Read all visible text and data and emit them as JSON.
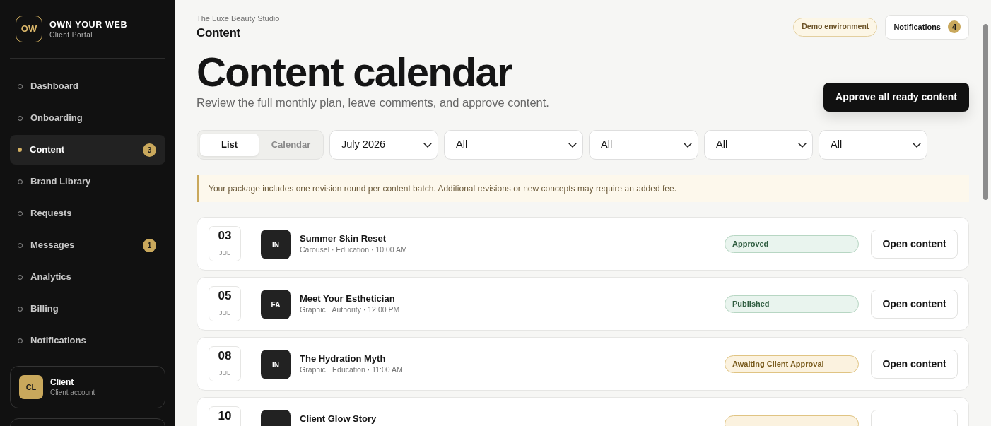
{
  "brand": {
    "logo": "OW",
    "name": "OWN YOUR WEB",
    "subtitle": "Client Portal"
  },
  "nav": [
    {
      "label": "Dashboard",
      "selected": false
    },
    {
      "label": "Onboarding",
      "selected": false
    },
    {
      "label": "Content",
      "selected": true,
      "badge": "3"
    },
    {
      "label": "Brand Library",
      "selected": false
    },
    {
      "label": "Requests",
      "selected": false
    },
    {
      "label": "Messages",
      "selected": false,
      "badge": "1"
    },
    {
      "label": "Analytics",
      "selected": false
    },
    {
      "label": "Billing",
      "selected": false
    },
    {
      "label": "Notifications",
      "selected": false
    }
  ],
  "account": {
    "initials": "CL",
    "name": "Client",
    "role": "Client account"
  },
  "header": {
    "breadcrumb": "The Luxe Beauty Studio",
    "title": "Content",
    "environment_badge": "Demo environment",
    "notifications": {
      "label": "Notifications",
      "count": "4"
    }
  },
  "page": {
    "title": "Content calendar",
    "subtitle": "Review the full monthly plan, leave comments, and approve content.",
    "primary_action": "Approve all ready content"
  },
  "view_toggle": [
    {
      "label": "List",
      "selected": true
    },
    {
      "label": "Calendar",
      "selected": false
    }
  ],
  "filters": [
    {
      "value": "July 2026"
    },
    {
      "value": "All"
    },
    {
      "value": "All"
    },
    {
      "value": "All"
    },
    {
      "value": "All"
    }
  ],
  "notice": "Your package includes one revision round per content batch. Additional revisions or new concepts may require an added fee.",
  "items": [
    {
      "day": "03",
      "month": "JUL",
      "initials": "IN",
      "title": "Summer Skin Reset",
      "meta": "Carousel · Education · 10:00 AM",
      "status": {
        "kind": "approved",
        "label": "Approved"
      },
      "action": "Open content"
    },
    {
      "day": "05",
      "month": "JUL",
      "initials": "FA",
      "title": "Meet Your Esthetician",
      "meta": "Graphic · Authority · 12:00 PM",
      "status": {
        "kind": "published",
        "label": "Published"
      },
      "action": "Open content"
    },
    {
      "day": "08",
      "month": "JUL",
      "initials": "IN",
      "title": "The Hydration Myth",
      "meta": "Graphic · Education · 11:00 AM",
      "status": {
        "kind": "awaiting",
        "label": "Awaiting Client Approval"
      },
      "action": "Open content"
    },
    {
      "day": "10",
      "title": "Client Glow Story",
      "status": {
        "kind": "awaiting"
      }
    }
  ]
}
